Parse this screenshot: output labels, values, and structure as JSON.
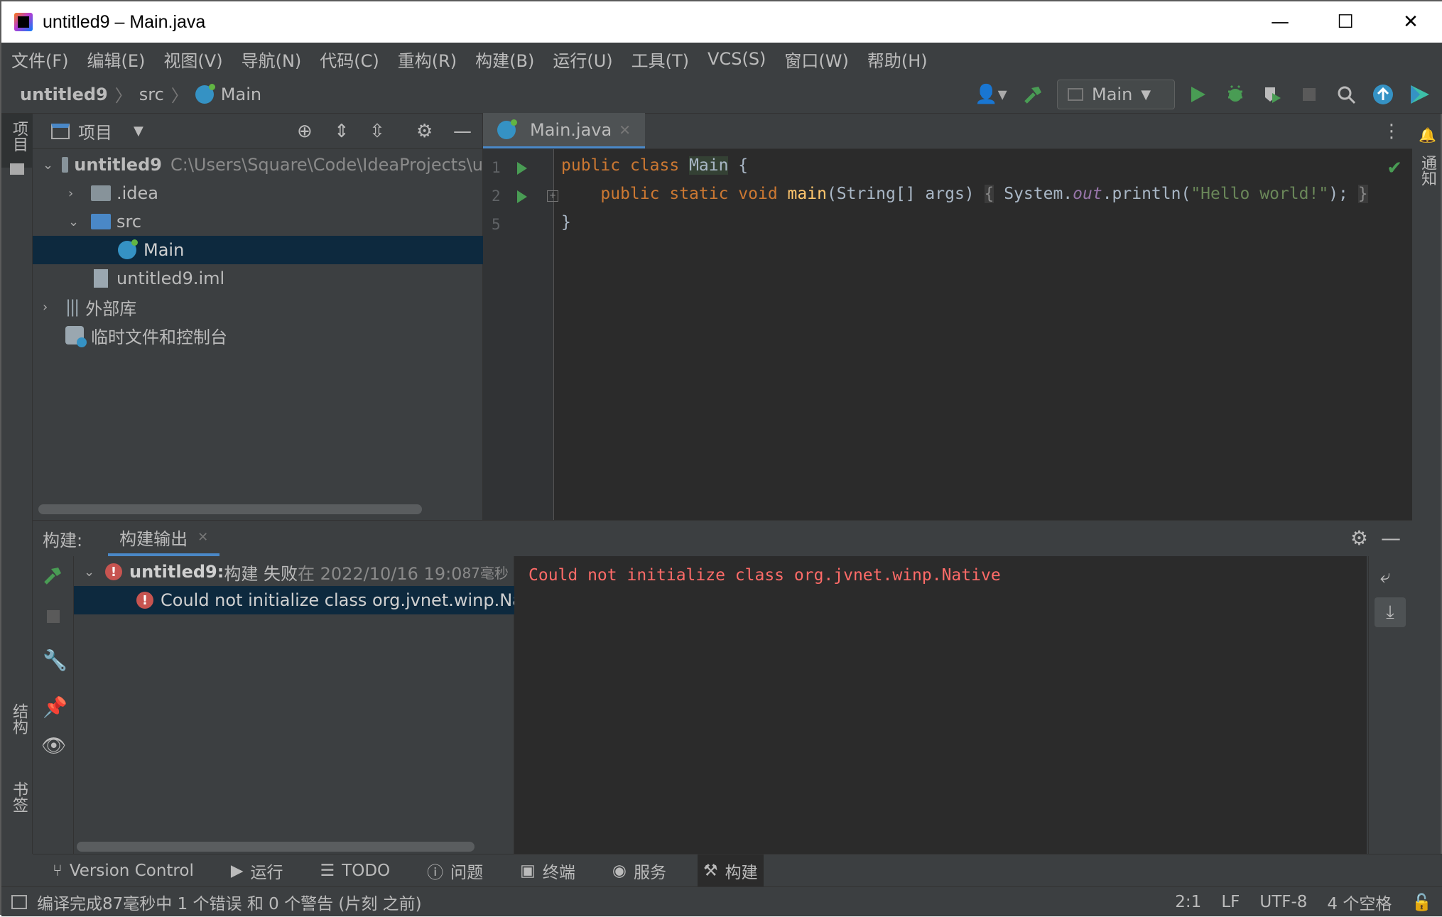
{
  "window": {
    "title": "untitled9 – Main.java",
    "controls": {
      "minimize": "—",
      "maximize": "☐",
      "close": "✕"
    }
  },
  "menu": [
    "文件(F)",
    "编辑(E)",
    "视图(V)",
    "导航(N)",
    "代码(C)",
    "重构(R)",
    "构建(B)",
    "运行(U)",
    "工具(T)",
    "VCS(S)",
    "窗口(W)",
    "帮助(H)"
  ],
  "breadcrumb": {
    "project": "untitled9",
    "folder": "src",
    "file": "Main"
  },
  "toolbar": {
    "run_config": "Main"
  },
  "left_stripe": {
    "project_tab": "项目",
    "structure_tab": "结构",
    "bookmarks_tab": "书签"
  },
  "right_stripe": {
    "notifications_tab": "通知"
  },
  "project_panel": {
    "title": "项目",
    "tree": [
      {
        "label": "untitled9",
        "path": "C:\\Users\\Square\\Code\\IdeaProjects\\u"
      },
      {
        "label": ".idea"
      },
      {
        "label": "src"
      },
      {
        "label": "Main"
      },
      {
        "label": "untitled9.iml"
      },
      {
        "label": "外部库"
      },
      {
        "label": "临时文件和控制台"
      }
    ]
  },
  "editor": {
    "tab_label": "Main.java",
    "line_numbers": [
      "1",
      "2",
      "5"
    ],
    "code": {
      "l1_kw1": "public",
      "l1_kw2": "class",
      "l1_cls": "Main",
      "l1_end": " {",
      "l2_kw1": "public",
      "l2_kw2": "static",
      "l2_kw3": "void",
      "l2_fn": "main",
      "l2_params": "(String[] args) ",
      "l2_open": "{",
      "l2_sys": " System.",
      "l2_out": "out",
      "l2_println": ".println(",
      "l2_str": "\"Hello world!\"",
      "l2_end": ");",
      "l2_close": "}",
      "l3": "}"
    }
  },
  "build_panel": {
    "label": "构建:",
    "tab": "构建输出",
    "tree": {
      "root_name": "untitled9:",
      "root_status": " 构建 失败",
      "root_time": " 在 2022/10/16 19:0",
      "root_duration": "87毫秒",
      "error_item": "Could not initialize class org.jvnet.winp.Nati"
    },
    "output": "Could not initialize class org.jvnet.winp.Native"
  },
  "tool_windows": [
    "Version Control",
    "运行",
    "TODO",
    "问题",
    "终端",
    "服务",
    "构建"
  ],
  "status_bar": {
    "message": "编译完成87毫秒中 1 个错误 和 0 个警告 (片刻 之前)",
    "position": "2:1",
    "line_sep": "LF",
    "encoding": "UTF-8",
    "indent": "4 个空格"
  },
  "colors": {
    "keyword": "#cc7832",
    "function": "#ffc66d",
    "string": "#6a8759",
    "error": "#ff6b68",
    "run": "#499c54",
    "accent": "#4a88c7"
  }
}
